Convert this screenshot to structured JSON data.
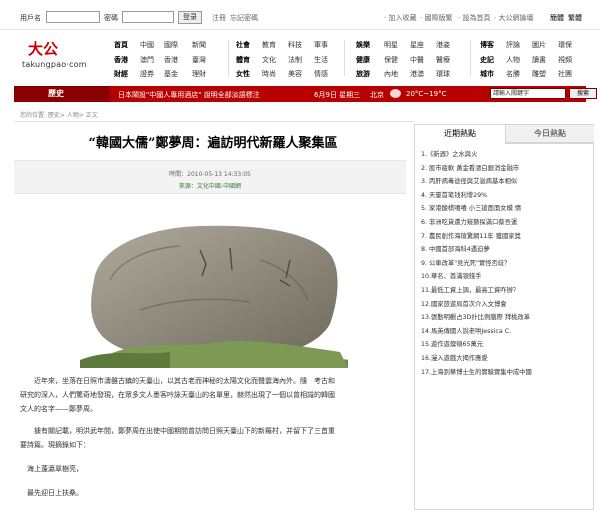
{
  "topbar": {
    "username_label": "用戶名",
    "password_label": "密碼",
    "login_button": "登录",
    "register_link": "注冊",
    "forgot_link": "忘記密碼",
    "add_fav": "· 加入收藏",
    "switch_lang": "· 國際版繁",
    "set_home": "· 設為首頁",
    "ta_forum": "· 大公網論壇",
    "traditional": "簡體",
    "simplified": "繁體"
  },
  "logo": {
    "cn": "大公",
    "en": "takungpao·com"
  },
  "nav": {
    "col1": [
      "首頁",
      "香港",
      "財經"
    ],
    "col2": [
      "中國",
      "澳門",
      "證券"
    ],
    "col3": [
      "國際",
      "香港",
      "基金"
    ],
    "col4": [
      "新聞",
      "臺灣",
      "理財"
    ],
    "col5": [
      "社會",
      "體育",
      "女性"
    ],
    "col6": [
      "教育",
      "文化",
      "時尚"
    ],
    "col7": [
      "科技",
      "法制",
      "美容"
    ],
    "col8": [
      "軍事",
      "生活",
      "情感"
    ],
    "col9": [
      "娛樂",
      "健康",
      "旅游"
    ],
    "col10": [
      "明星",
      "保健",
      "內地"
    ],
    "col11": [
      "星座",
      "中醫",
      "港澳"
    ],
    "col12": [
      "港姿",
      "醫療",
      "環球"
    ],
    "col13": [
      "博客",
      "史記",
      "城市"
    ],
    "col14": [
      "評論",
      "人物",
      "名勝"
    ],
    "col15": [
      "圖片",
      "讀書",
      "雕塑"
    ],
    "col16": [
      "環保",
      "視頻",
      "社團"
    ]
  },
  "redbar": {
    "section": "歷史",
    "news": "日本鬧設\"中國人專用酒店\" 說明全部淡語標注",
    "date": "6月9日 星期三",
    "city": "北京",
    "temp": "20°C~19°C",
    "search_placeholder": "請輸入關鍵字",
    "search_button": "搜索"
  },
  "breadcrumb": "您的位置: 歷史> 人物> 正文",
  "article": {
    "title": "“韓國大儒”鄭夢周：遍訪明代新羅人聚集區",
    "time": "時間：2010-05-13 14:33:05",
    "source": "來源：文化中國-中國網",
    "p1_line1": "　　近年來，坐落在日照市濤雒古鎮的天臺山，以其古老而神秘的太陽文化而聲震海內外。隨　考古和",
    "p1_line2": "研究的深入，人們驚奇地發現，在眾多文人墨客吟詠天臺山的名單里，赫然出現了一個以曾相識的韓國",
    "p1_line3": "文人的名字——鄭夢周。",
    "p2_line1": "　　據有關記載，明洪武年間，鄭夢周在出使中國期間曾訪問日照天臺山下的新羅村，并留下了三首重",
    "p2_line2": "要詩篇。現摘錄如下：",
    "p3": "　海上蓬瀛翠樹亮，",
    "p4": "　最先迎日上扶桑。"
  },
  "sidebar": {
    "tab_recent": "近期熱點",
    "tab_today": "今日熱點",
    "items": [
      "1.《新週》之水與火",
      "2. 股市疲軟 黃金看漲白銀消金融市",
      "3. 丙肝病毒途徑與艾滋病基本相似",
      "4. 天臺首笔钱利增29%",
      "5. 家港酸棋嘻嘻 小三搶面面女模 情",
      "6. 非洲吃貨遭力窺藝探滿口蔡吾運",
      "7. 農民創作海瑄驚網11年 獲國家獎",
      "8. 中國首部海科4遇迫夢",
      "9. 公車改革\"見光死\"實怪否歧？",
      "10.華名、酋滿領錢手",
      "11.最低工資上調，最高工資咋辦？",
      "12.國家旅遊局首次介入文博會",
      "13.張勤明觀占3D扑比例腦際 拜桃改革",
      "14.馬英傳國人說老哄Jessica C.",
      "15.遊作遊燦頓65萬元",
      "16.漫入遊戲大揭作應愛",
      "17.上海到華博士生的實驗實集中成中國"
    ]
  }
}
